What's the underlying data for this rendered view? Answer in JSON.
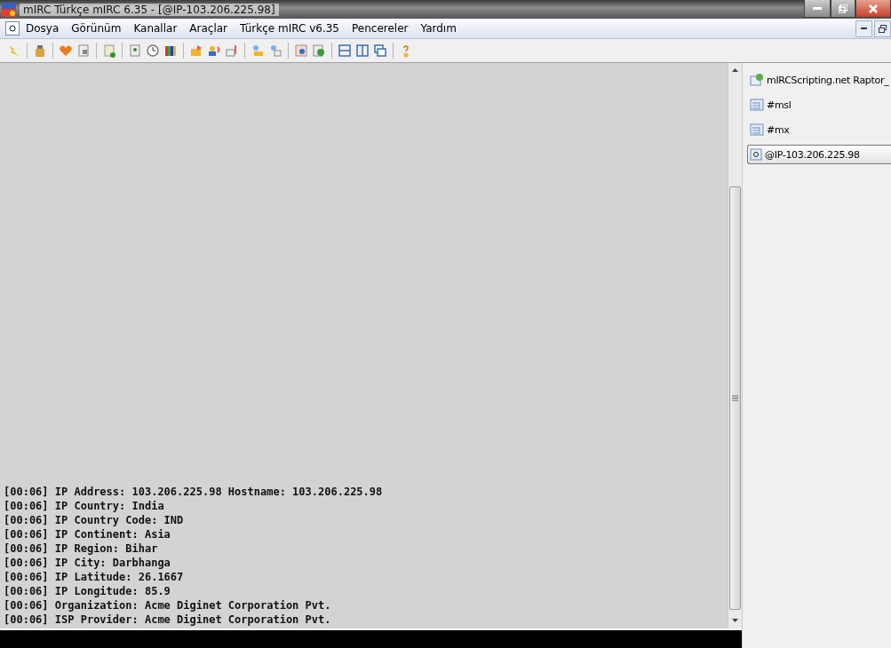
{
  "window": {
    "title": "mIRC Türkçe mIRC 6.35 - [@IP-103.206.225.98]"
  },
  "menu": [
    "Dosya",
    "Görünüm",
    "Kanallar",
    "Araçlar",
    "Türkçe mIRC v6.35",
    "Pencereler",
    "Yardım"
  ],
  "log": [
    "[00:06] IP Address: 103.206.225.98 Hostname: 103.206.225.98",
    "[00:06] IP Country: India",
    "[00:06] IP Country Code: IND",
    "[00:06] IP Continent: Asia",
    "[00:06] IP Region: Bihar",
    "[00:06] IP City: Darbhanga",
    "[00:06] IP Latitude: 26.1667",
    "[00:06] IP Longitude: 85.9",
    "[00:06] Organization: Acme Diginet Corporation Pvt.",
    "[00:06] ISP Provider: Acme Diginet Corporation Pvt."
  ],
  "treebar": [
    {
      "label": "mIRCScripting.net Raptor_",
      "kind": "status",
      "selected": false
    },
    {
      "label": "#msl",
      "kind": "channel",
      "selected": false
    },
    {
      "label": "#mx",
      "kind": "channel",
      "selected": false
    },
    {
      "label": "@IP-103.206.225.98",
      "kind": "query",
      "selected": true
    }
  ]
}
